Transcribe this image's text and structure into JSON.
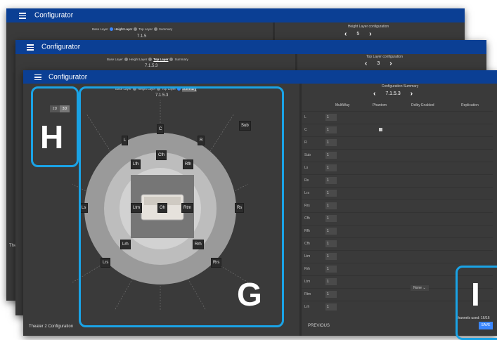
{
  "windows": [
    {
      "title": "Configurator",
      "breadcrumb": {
        "base": "Base Layer",
        "height": "Height Layer",
        "top": "Top Layer",
        "summary": "Summary"
      },
      "config": "7.1.5",
      "panel_title": "Height Layer configuration",
      "panel_value": "5",
      "side_label": "Theat"
    },
    {
      "title": "Configurator",
      "breadcrumb": {
        "base": "Base Layer",
        "height": "Height Layer",
        "top": "Top Layer",
        "summary": "Summary"
      },
      "config": "7.1.5.3",
      "panel_title": "Top Layer configuration",
      "panel_value": "3"
    },
    {
      "title": "Configurator",
      "breadcrumb": {
        "base": "Base Layer",
        "height": "Height Layer",
        "top": "Top Layer",
        "summary": "Summary"
      },
      "config": "7.1.5.3",
      "panel_title": "Configuration Summary",
      "panel_value": "7.1.5.3",
      "view_toggle": {
        "two_d": "2D",
        "three_d": "3D"
      },
      "speakers": {
        "c": "C",
        "l": "L",
        "r": "R",
        "sub": "Sub",
        "cfh": "Cfh",
        "lfh": "Lfh",
        "rfh": "Rfh",
        "ltm": "Ltm",
        "oh": "Oh",
        "rtm": "Rtm",
        "ls": "Ls",
        "rs": "Rs",
        "lrh": "Lrh",
        "rrh": "Rrh",
        "lrs": "Lrs",
        "rrs": "Rrs"
      },
      "table": {
        "headers": [
          "MultiWay",
          "Phantom",
          "Dolby Enabled",
          "Replication"
        ],
        "rows": [
          {
            "label": "L",
            "val": "1"
          },
          {
            "label": "C",
            "val": "1",
            "phantom": true
          },
          {
            "label": "R",
            "val": "1"
          },
          {
            "label": "Sub",
            "val": "1"
          },
          {
            "label": "Ls",
            "val": "1"
          },
          {
            "label": "Rs",
            "val": "1"
          },
          {
            "label": "Lrs",
            "val": "1"
          },
          {
            "label": "Rrs",
            "val": "1"
          },
          {
            "label": "Cfh",
            "val": "1"
          },
          {
            "label": "Rfh",
            "val": "1"
          },
          {
            "label": "Cfh",
            "val": "1"
          },
          {
            "label": "Ltm",
            "val": "1"
          },
          {
            "label": "Rrh",
            "val": "1"
          },
          {
            "label": "Ltm",
            "val": "1"
          },
          {
            "label": "Rtm",
            "val": "1"
          },
          {
            "label": "Lrh",
            "val": "1"
          }
        ],
        "dropdown": "None"
      },
      "channels_used": "channels used: 16/16",
      "previous": "PREVIOUS",
      "save": "SAVE",
      "footer": "Theater 2 Configuration"
    }
  ],
  "annotations": {
    "g": "G",
    "h": "H",
    "i": "I"
  },
  "colors": {
    "titlebar": "#0b3f94",
    "panel": "#3a3a3a",
    "accent": "#3a86ff",
    "annotation": "#1aa3e6"
  }
}
